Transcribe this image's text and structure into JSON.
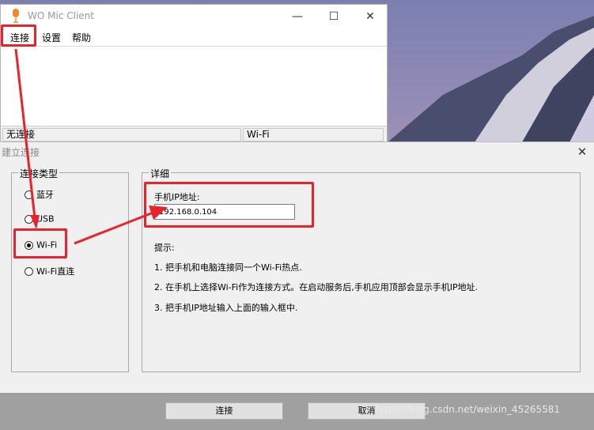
{
  "main_window": {
    "title": "WO Mic Client",
    "menu": [
      "连接",
      "设置",
      "帮助"
    ],
    "status_left": "无连接",
    "status_right": "Wi-Fi"
  },
  "dialog": {
    "title": "建立连接",
    "connection_type_label": "连接类型",
    "options": [
      "蓝牙",
      "USB",
      "Wi-Fi",
      "Wi-Fi直连"
    ],
    "selected_option": "Wi-Fi",
    "details_label": "详细",
    "ip_label": "手机IP地址:",
    "ip_value": "192.168.0.104",
    "tips_heading": "提示:",
    "tips": [
      "1. 把手机和电脑连接同一个Wi-Fi热点.",
      "2. 在手机上选择Wi-Fi作为连接方式。在启动服务后,手机应用顶部会显示手机IP地址.",
      "3. 把手机IP地址输入上面的输入框中."
    ],
    "connect_button": "连接",
    "cancel_button": "取消"
  },
  "watermark": "https://blog.csdn.net/weixin_45265581",
  "colors": {
    "annotation_red": "#e8232b",
    "dialog_bg": "#f0f0f0",
    "bottom_bar": "#a0a0a0"
  }
}
